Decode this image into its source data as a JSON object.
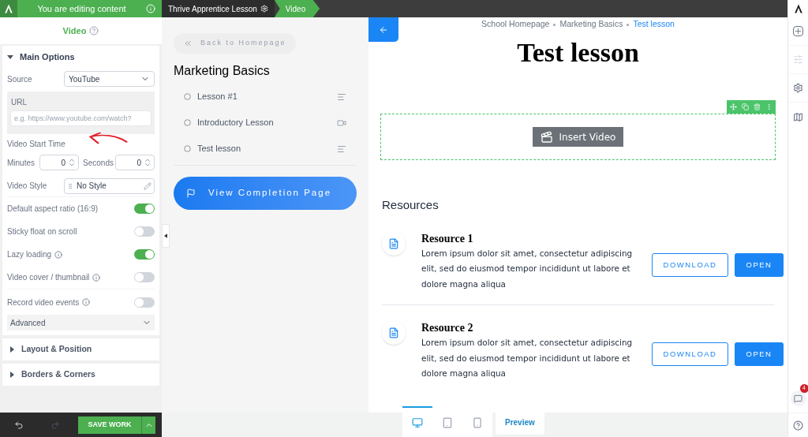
{
  "editor_header": {
    "title": "You are editing content"
  },
  "element_title": "Video",
  "main_options": {
    "title": "Main Options",
    "expanded": true
  },
  "source": {
    "label": "Source",
    "value": "YouTube"
  },
  "url": {
    "label": "URL",
    "placeholder": "e.g. https://www.youtube.com/watch?"
  },
  "start_time": {
    "label": "Video Start Time",
    "minutes": {
      "label": "Minutes",
      "value": "0"
    },
    "seconds": {
      "label": "Seconds",
      "value": "0"
    }
  },
  "video_style": {
    "label": "Video Style",
    "value": "No Style"
  },
  "toggles": [
    {
      "label": "Default aspect ratio (16:9)",
      "on": true,
      "info": false
    },
    {
      "label": "Sticky float on scroll",
      "on": false,
      "info": false
    },
    {
      "label": "Lazy loading",
      "on": true,
      "info": true
    },
    {
      "label": "Video cover / thumbnail",
      "on": false,
      "info": true
    },
    {
      "label": "Record video events",
      "on": false,
      "info": true
    }
  ],
  "advanced": {
    "label": "Advanced",
    "expanded": false
  },
  "collapsed_sections": [
    {
      "title": "Layout & Position",
      "expanded": false
    },
    {
      "title": "Borders & Corners",
      "expanded": false
    }
  ],
  "save_button": "SAVE WORK",
  "top_bar": {
    "items": [
      {
        "label": "Thrive Apprentice Lesson",
        "selected": false
      },
      {
        "label": "Video",
        "selected": true
      }
    ]
  },
  "course_sidebar": {
    "back_link": "Back to Homepage",
    "title": "Marketing Basics",
    "lessons": [
      {
        "title": "Lesson #1",
        "kind": "text"
      },
      {
        "title": "Introductory Lesson",
        "kind": "video"
      },
      {
        "title": "Test lesson",
        "kind": "text"
      }
    ],
    "completion_button": "View Completion Page"
  },
  "page": {
    "breadcrumbs": [
      {
        "label": "School Homepage",
        "selected": false
      },
      {
        "label": "Marketing Basics",
        "selected": false
      },
      {
        "label": "Test lesson",
        "selected": true
      }
    ],
    "title": "Test lesson",
    "insert_video": "Insert Video",
    "resources_heading": "Resources",
    "resources": [
      {
        "title": "Resource 1",
        "description": "Lorem ipsum dolor sit amet, consectetur adipiscing elit, sed do eiusmod tempor incididunt ut labore et dolore magna aliqua",
        "download": "DOWNLOAD",
        "open": "OPEN"
      },
      {
        "title": "Resource 2",
        "description": "Lorem ipsum dolor sit amet, consectetur adipiscing elit, sed do eiusmod tempor incididunt ut labore et dolore magna aliqua",
        "download": "DOWNLOAD",
        "open": "OPEN"
      }
    ]
  },
  "device_bar": {
    "devices": [
      {
        "kind": "desktop",
        "selected": true
      },
      {
        "kind": "tablet",
        "selected": false
      },
      {
        "kind": "mobile",
        "selected": false
      }
    ],
    "preview": "Preview"
  },
  "notification_count": "4"
}
